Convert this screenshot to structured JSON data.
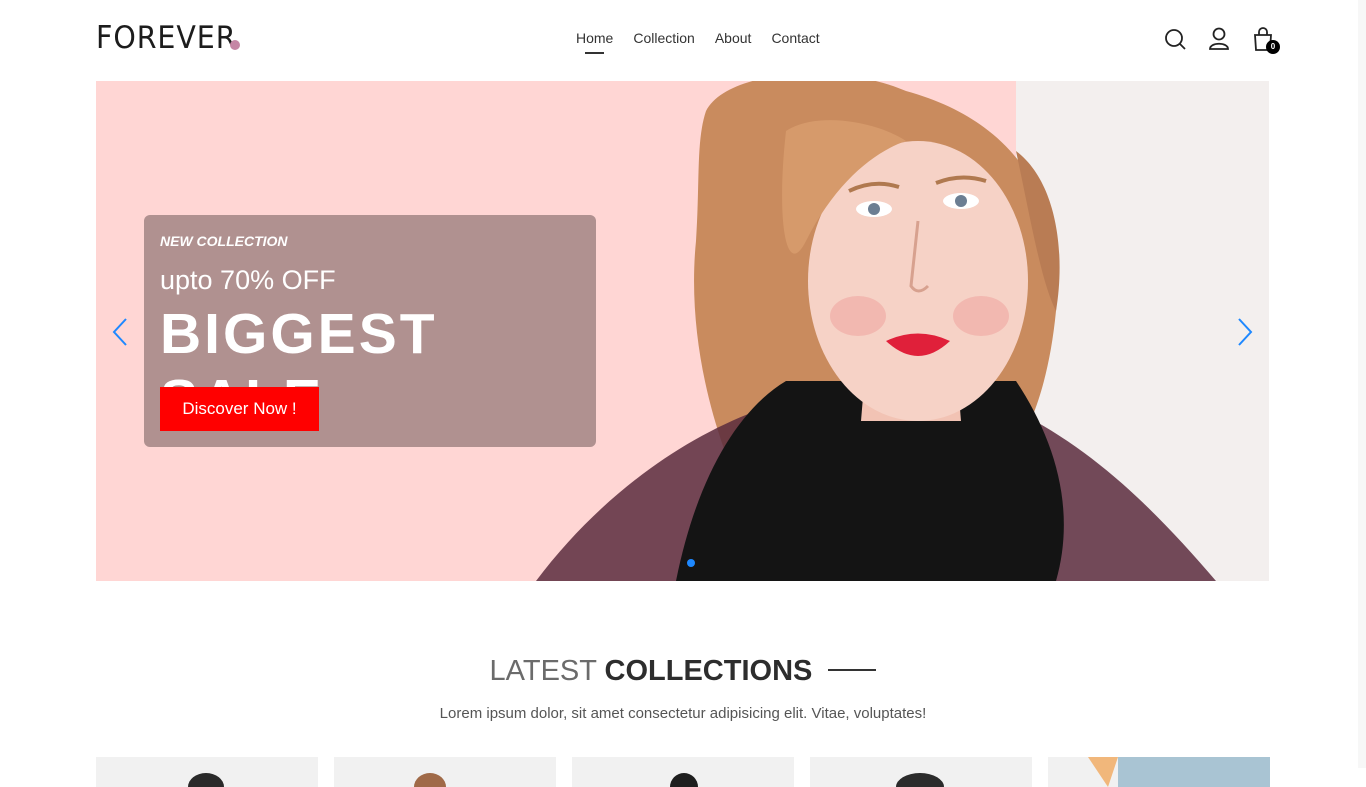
{
  "brand": {
    "name": "FOREVER",
    "dot_color": "#c586a5"
  },
  "nav": {
    "items": [
      {
        "label": "Home",
        "active": true
      },
      {
        "label": "Collection"
      },
      {
        "label": "About"
      },
      {
        "label": "Contact"
      }
    ]
  },
  "header_icons": {
    "search": "search-icon",
    "profile": "user-icon",
    "cart": "shopping-bag-icon",
    "cart_count": "0"
  },
  "hero": {
    "kicker": "NEW COLLECTION",
    "subtitle": "upto 70% OFF",
    "title": "BIGGEST SALE",
    "cta_label": "Discover Now !",
    "background_color": "#ffd6d4",
    "cta_color": "#ff0000",
    "arrow_color": "#1e88ff"
  },
  "latest": {
    "title_light": "LATEST",
    "title_bold": "COLLECTIONS",
    "description": "Lorem ipsum dolor, sit amet consectetur adipisicing elit. Vitae, voluptates!"
  }
}
